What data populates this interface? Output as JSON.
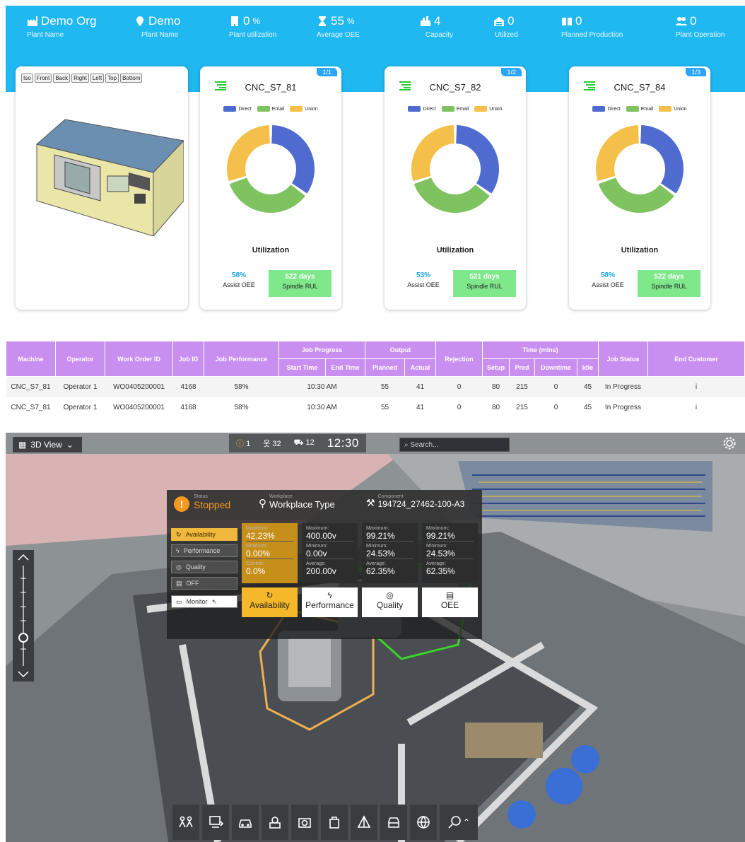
{
  "kpis": [
    {
      "value": "Demo Org",
      "label": "Plant Name",
      "icon": "factory-icon"
    },
    {
      "value": "Demo",
      "label": "Plant Name",
      "icon": "location-pin-icon"
    },
    {
      "value": "0",
      "unit": "%",
      "label": "Plant utilization",
      "icon": "building-icon"
    },
    {
      "value": "55",
      "unit": "%",
      "label": "Average OEE",
      "icon": "hourglass-icon"
    },
    {
      "value": "4",
      "label": "Capacity",
      "icon": "factory-chart-icon"
    },
    {
      "value": "0",
      "label": "Utilized",
      "icon": "garage-icon"
    },
    {
      "value": "0",
      "label": "Planned Production",
      "icon": "book-icon"
    },
    {
      "value": "0",
      "label": "Plant Operation",
      "icon": "users-icon"
    }
  ],
  "view_buttons": [
    "Iso",
    "Front",
    "Back",
    "Right",
    "Left",
    "Top",
    "Bottom"
  ],
  "legend": [
    {
      "label": "Direct",
      "color": "#4f6bd0"
    },
    {
      "label": "Email",
      "color": "#7fc360"
    },
    {
      "label": "Union",
      "color": "#f5c04a"
    }
  ],
  "machines": [
    {
      "name": "CNC_S7_81",
      "page": "1/1",
      "oee": "58%",
      "oee_label": "Assist OEE",
      "rul": "522 days",
      "rul_label": "Spindle RUL",
      "util_label": "Utilization"
    },
    {
      "name": "CNC_S7_82",
      "page": "1/2",
      "oee": "53%",
      "oee_label": "Assist OEE",
      "rul": "521 days",
      "rul_label": "Spindle RUL",
      "util_label": "Utilization"
    },
    {
      "name": "CNC_S7_84",
      "page": "1/3",
      "oee": "58%",
      "oee_label": "Assist OEE",
      "rul": "522 days",
      "rul_label": "Spindle RUL",
      "util_label": "Utilization"
    }
  ],
  "chart_data": [
    {
      "type": "pie",
      "title": "CNC_S7_81",
      "series": [
        "Direct",
        "Email",
        "Union"
      ],
      "values": [
        35,
        35,
        30
      ]
    },
    {
      "type": "pie",
      "title": "CNC_S7_82",
      "series": [
        "Direct",
        "Email",
        "Union"
      ],
      "values": [
        35,
        35,
        30
      ]
    },
    {
      "type": "pie",
      "title": "CNC_S7_84",
      "series": [
        "Direct",
        "Email",
        "Union"
      ],
      "values": [
        35,
        35,
        30
      ]
    }
  ],
  "table": {
    "h1": [
      "Machine",
      "Operator",
      "Work Order ID",
      "Job ID",
      "Job Performance",
      "Job Progress",
      "Output",
      "Rejection",
      "Time (mins)",
      "Job Status",
      "End Customer"
    ],
    "h2": [
      "Start Time",
      "End Time",
      "Planned",
      "Actual",
      "Setup",
      "Pred",
      "Downtime",
      "Idle"
    ],
    "rows": [
      [
        "CNC_S7_81",
        "Operator 1",
        "WO0405200001",
        "4168",
        "58%",
        "10:30 AM",
        "55",
        "41",
        "0",
        "80",
        "215",
        "0",
        "45",
        "In Progress",
        "i"
      ],
      [
        "CNC_S7_81",
        "Operator 1",
        "WO0405200001",
        "4168",
        "58%",
        "10:30 AM",
        "55",
        "41",
        "0",
        "80",
        "215",
        "0",
        "45",
        "In Progress",
        "i"
      ]
    ]
  },
  "scene": {
    "view_label": "3D View",
    "alerts": "1",
    "people": "32",
    "vehicles": "12",
    "clock": "12:30",
    "search_placeholder": "Search..."
  },
  "panel": {
    "status_key": "Status",
    "status": "Stopped",
    "workplace_key": "Workplace",
    "workplace": "Workplace Type",
    "component_key": "Component",
    "component": "194724_27462-100-A3",
    "buttons": [
      "Availability",
      "Performance",
      "Quality",
      "OFF"
    ],
    "monitor": "Monitor",
    "columns": [
      [
        {
          "k": "Maximum:",
          "v": "42.23%"
        },
        {
          "k": "Minimum:",
          "v": "0.00%"
        },
        {
          "k": "Current:",
          "v": "0.0%"
        }
      ],
      [
        {
          "k": "Maximum:",
          "v": "400.00v"
        },
        {
          "k": "Minimum:",
          "v": "0.00v"
        },
        {
          "k": "Average:",
          "v": "200.00v"
        }
      ],
      [
        {
          "k": "Maximum:",
          "v": "99.21%"
        },
        {
          "k": "Minimum:",
          "v": "24.53%"
        },
        {
          "k": "Average:",
          "v": "62.35%"
        }
      ],
      [
        {
          "k": "Maximum:",
          "v": "99.21%"
        },
        {
          "k": "Minimum:",
          "v": "24.53%"
        },
        {
          "k": "Average:",
          "v": "62.35%"
        }
      ]
    ],
    "tabs": [
      "Availability",
      "Performance",
      "Quality",
      "OEE"
    ]
  },
  "colors": {
    "topbar": "#1fb8f1",
    "header": "#c98ff0",
    "accent": "#f5b82a",
    "rul": "#7ee88b"
  }
}
